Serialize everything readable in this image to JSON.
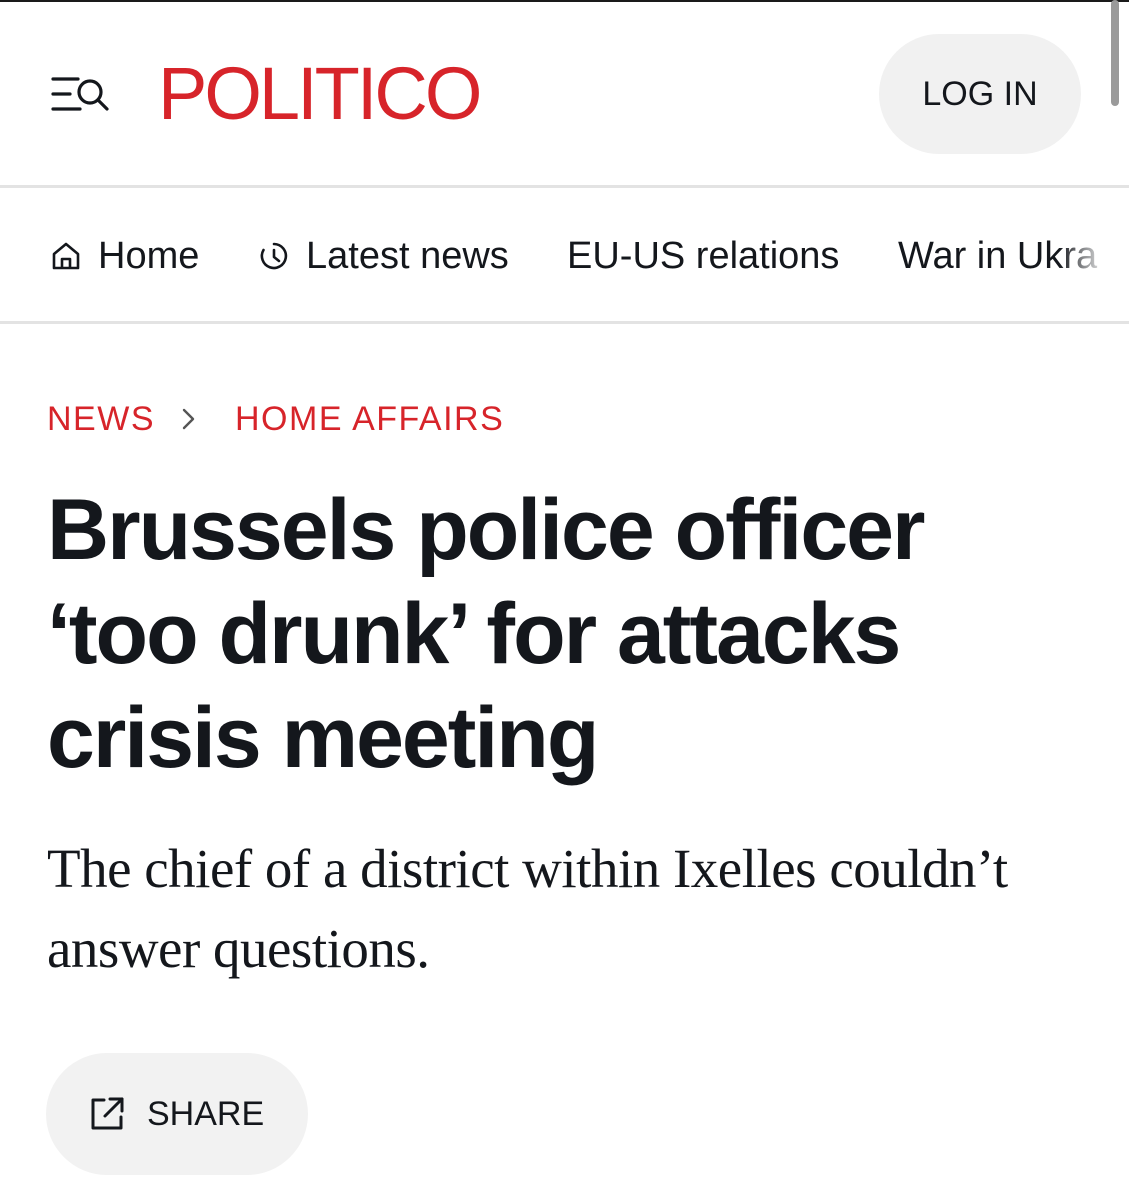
{
  "header": {
    "logo_text": "POLITICO",
    "login_label": "LOG IN",
    "menu_icon": "menu-search-icon",
    "brand_color": "#d7242a"
  },
  "nav": {
    "items": [
      {
        "label": "Home",
        "icon": "home-icon"
      },
      {
        "label": "Latest news",
        "icon": "clock-icon"
      },
      {
        "label": "EU-US relations"
      },
      {
        "label": "War in Ukra"
      }
    ]
  },
  "breadcrumb": {
    "items": [
      "NEWS",
      "HOME AFFAIRS"
    ],
    "separator_icon": "chevron-right-icon"
  },
  "article": {
    "headline": "Brussels police officer ‘too drunk’ for attacks crisis meeting",
    "dek": "The chief of a district within Ixelles couldn’t answer questions."
  },
  "share": {
    "label": "SHARE",
    "icon": "share-external-icon"
  }
}
